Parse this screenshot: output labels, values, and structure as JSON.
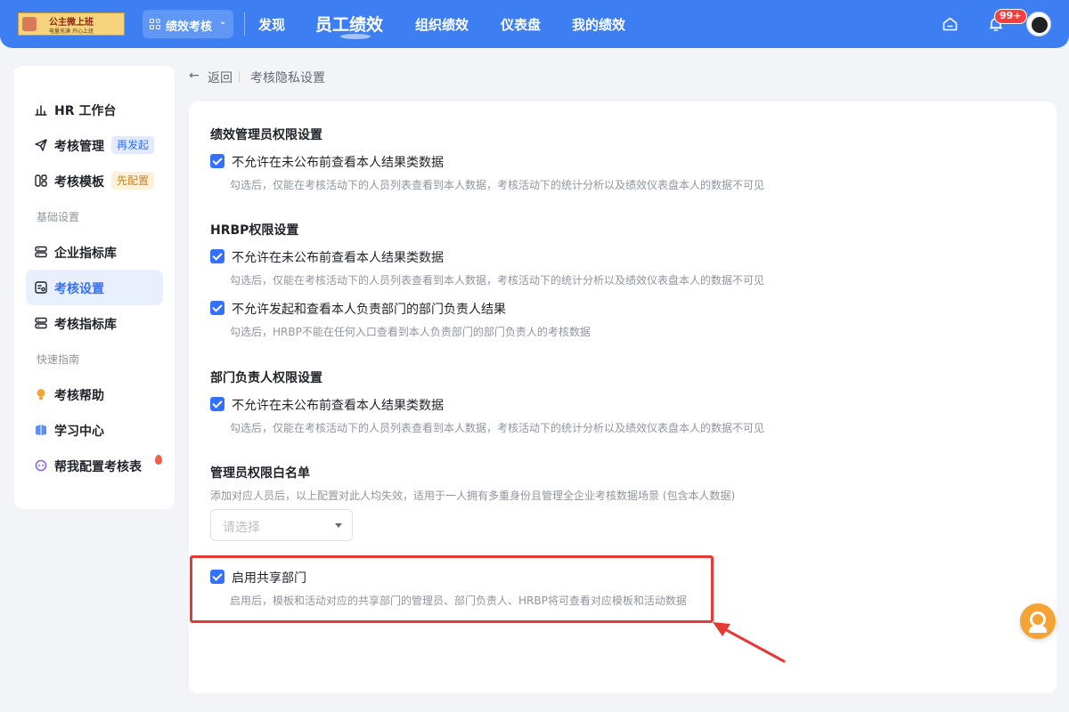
{
  "header": {
    "logo": {
      "title": "公主微上班",
      "subtitle": "电量充满 开心上班"
    },
    "app_switch": "绩效考核",
    "nav": [
      "发现",
      "员工绩效",
      "组织绩效",
      "仪表盘",
      "我的绩效"
    ],
    "active_nav": "员工绩效",
    "notification_badge": "99+",
    "accent": "#3d7ff2"
  },
  "sidebar": {
    "items": [
      {
        "label": "HR 工作台",
        "icon": "chart-bar-icon"
      },
      {
        "label": "考核管理",
        "icon": "paper-plane-icon",
        "tag": "再发起"
      },
      {
        "label": "考核模板",
        "icon": "template-icon",
        "tag": "先配置"
      }
    ],
    "group_basic": "基础设置",
    "basic_items": [
      {
        "label": "企业指标库",
        "icon": "indicator-library-icon"
      },
      {
        "label": "考核设置",
        "icon": "settings-card-icon",
        "active": true
      },
      {
        "label": "考核指标库",
        "icon": "indicator-library-icon"
      }
    ],
    "group_guide": "快速指南",
    "guide_items": [
      {
        "label": "考核帮助",
        "icon": "lightbulb-icon"
      },
      {
        "label": "学习中心",
        "icon": "book-icon"
      },
      {
        "label": "帮我配置考核表",
        "icon": "assistant-icon"
      }
    ]
  },
  "breadcrumb": {
    "back": "返回",
    "title": "考核隐私设置"
  },
  "sections": {
    "admin": {
      "title": "绩效管理员权限设置",
      "opt1": {
        "label": "不允许在未公布前查看本人结果类数据",
        "hint": "勾选后，仅能在考核活动下的人员列表查看到本人数据，考核活动下的统计分析以及绩效仪表盘本人的数据不可见",
        "checked": true
      }
    },
    "hrbp": {
      "title": "HRBP权限设置",
      "opt1": {
        "label": "不允许在未公布前查看本人结果类数据",
        "hint": "勾选后，仅能在考核活动下的人员列表查看到本人数据，考核活动下的统计分析以及绩效仪表盘本人的数据不可见",
        "checked": true
      },
      "opt2": {
        "label": "不允许发起和查看本人负责部门的部门负责人结果",
        "hint": "勾选后，HRBP不能在任何入口查看到本人负责部门的部门负责人的考核数据",
        "checked": true
      }
    },
    "dept": {
      "title": "部门负责人权限设置",
      "opt1": {
        "label": "不允许在未公布前查看本人结果类数据",
        "hint": "勾选后，仅能在考核活动下的人员列表查看到本人数据，考核活动下的统计分析以及绩效仪表盘本人的数据不可见",
        "checked": true
      }
    },
    "whitelist": {
      "title": "管理员权限白名单",
      "hint": "添加对应人员后，以上配置对此人均失效，适用于一人拥有多重身份且管理全企业考核数据场景 (包含本人数据)",
      "placeholder": "请选择"
    },
    "shared": {
      "label": "启用共享部门",
      "hint": "启用后，模板和活动对应的共享部门的管理员、部门负责人、HRBP将可查看对应模板和活动数据",
      "checked": true
    }
  },
  "highlight_color": "#e53935"
}
